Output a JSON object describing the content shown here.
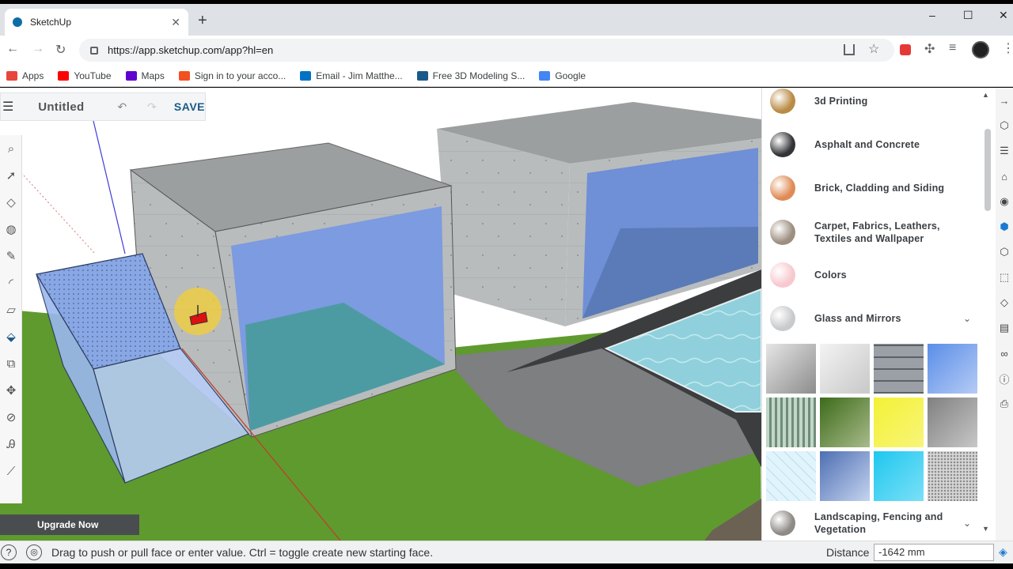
{
  "browser": {
    "tab_title": "SketchUp",
    "tab_close": "✕",
    "new_tab": "+",
    "url": "https://app.sketchup.com/app?hl=en",
    "window_controls": [
      "–",
      "☐",
      "✕"
    ]
  },
  "bookmarks": [
    {
      "label": "Apps",
      "icon": "apps-grid-icon",
      "color": "#e8453c"
    },
    {
      "label": "YouTube",
      "icon": "youtube-icon",
      "color": "#ff0000"
    },
    {
      "label": "Maps",
      "icon": "yahoo-icon",
      "color": "#5f01d1"
    },
    {
      "label": "Sign in to your acco...",
      "icon": "microsoft-icon",
      "color": "#f25022"
    },
    {
      "label": "Email - Jim Matthe...",
      "icon": "outlook-icon",
      "color": "#0072c6"
    },
    {
      "label": "Free 3D Modeling S...",
      "icon": "sketchup-icon",
      "color": "#1a5a8a"
    },
    {
      "label": "Google",
      "icon": "google-icon",
      "color": "#4285f4"
    }
  ],
  "app": {
    "menu_icon": "☰",
    "model_name": "Untitled",
    "undo": "↶",
    "redo": "↷",
    "save_label": "SAVE",
    "upgrade_label": "Upgrade Now"
  },
  "left_tools": [
    {
      "name": "search-tool",
      "glyph": "⌕"
    },
    {
      "name": "select-tool",
      "glyph": "➚"
    },
    {
      "name": "eraser-tool",
      "glyph": "◇"
    },
    {
      "name": "paint-bucket-tool",
      "glyph": "◍"
    },
    {
      "name": "pencil-tool",
      "glyph": "✎"
    },
    {
      "name": "arc-tool",
      "glyph": "◜"
    },
    {
      "name": "rectangle-tool",
      "glyph": "▱"
    },
    {
      "name": "push-pull-tool",
      "glyph": "⬙"
    },
    {
      "name": "offset-tool",
      "glyph": "⧉"
    },
    {
      "name": "move-tool",
      "glyph": "✥"
    },
    {
      "name": "tape-measure-tool",
      "glyph": "⊘"
    },
    {
      "name": "text-tool",
      "glyph": "Ꭿ"
    },
    {
      "name": "section-tool",
      "glyph": "⟋"
    }
  ],
  "materials": [
    {
      "label": "3d Printing",
      "color": "#b98b45"
    },
    {
      "label": "Asphalt and Concrete",
      "color": "#333437"
    },
    {
      "label": "Brick, Cladding and Siding",
      "color": "#e08b55"
    },
    {
      "label": "Carpet, Fabrics, Leathers, Textiles and Wallpaper",
      "color": "#9d8f80"
    },
    {
      "label": "Colors",
      "color": "#f7c9cf"
    },
    {
      "label": "Glass and Mirrors",
      "color": "#c9cacc",
      "expanded": true,
      "chevron": "⌄"
    },
    {
      "label": "Landscaping, Fencing and Vegetation",
      "color": "#8e8a86",
      "chevron": "⌄"
    }
  ],
  "glass_tiles": [
    {
      "name": "gray-gradient-swatch",
      "c1": "#e6e6e6",
      "c2": "#8c8c8c"
    },
    {
      "name": "light-gray-swatch",
      "c1": "#f3f3f3",
      "c2": "#c8c8c8"
    },
    {
      "name": "tiled-pattern-swatch",
      "c1": "#9aa0a6",
      "c2": "#5d6166"
    },
    {
      "name": "blue-glass-swatch",
      "c1": "#5a8ee8",
      "c2": "#b5cbf5"
    },
    {
      "name": "green-stripe-swatch",
      "c1": "#c2d6c7",
      "c2": "#6f8d7a"
    },
    {
      "name": "olive-glass-swatch",
      "c1": "#3d6b1a",
      "c2": "#a8bb8a"
    },
    {
      "name": "yellow-glass-swatch",
      "c1": "#f3f135",
      "c2": "#f8f57a"
    },
    {
      "name": "dark-gray-glass-swatch",
      "c1": "#808080",
      "c2": "#c7c7c7"
    },
    {
      "name": "light-blue-grid-swatch",
      "c1": "#e1f3fb",
      "c2": "#b7e2f2"
    },
    {
      "name": "cloudy-blue-swatch",
      "c1": "#4e6fb3",
      "c2": "#c5d4ef"
    },
    {
      "name": "cyan-glass-swatch",
      "c1": "#1ec7ef",
      "c2": "#7be0f7"
    },
    {
      "name": "speckled-swatch",
      "c1": "#d6d6d6",
      "c2": "#8a8a8a"
    }
  ],
  "right_tools": [
    "→",
    "⬡",
    "☰",
    "⌂",
    "◉",
    "⬢",
    "⬡",
    "⬚",
    "◇",
    "▤",
    "∞",
    "ⓘ",
    "⎙"
  ],
  "status": {
    "help": "?",
    "globe": "🌐",
    "message": "Drag to push or pull face or enter value. Ctrl = toggle create new starting face.",
    "distance_label": "Distance",
    "distance_value": "-1642 mm"
  }
}
